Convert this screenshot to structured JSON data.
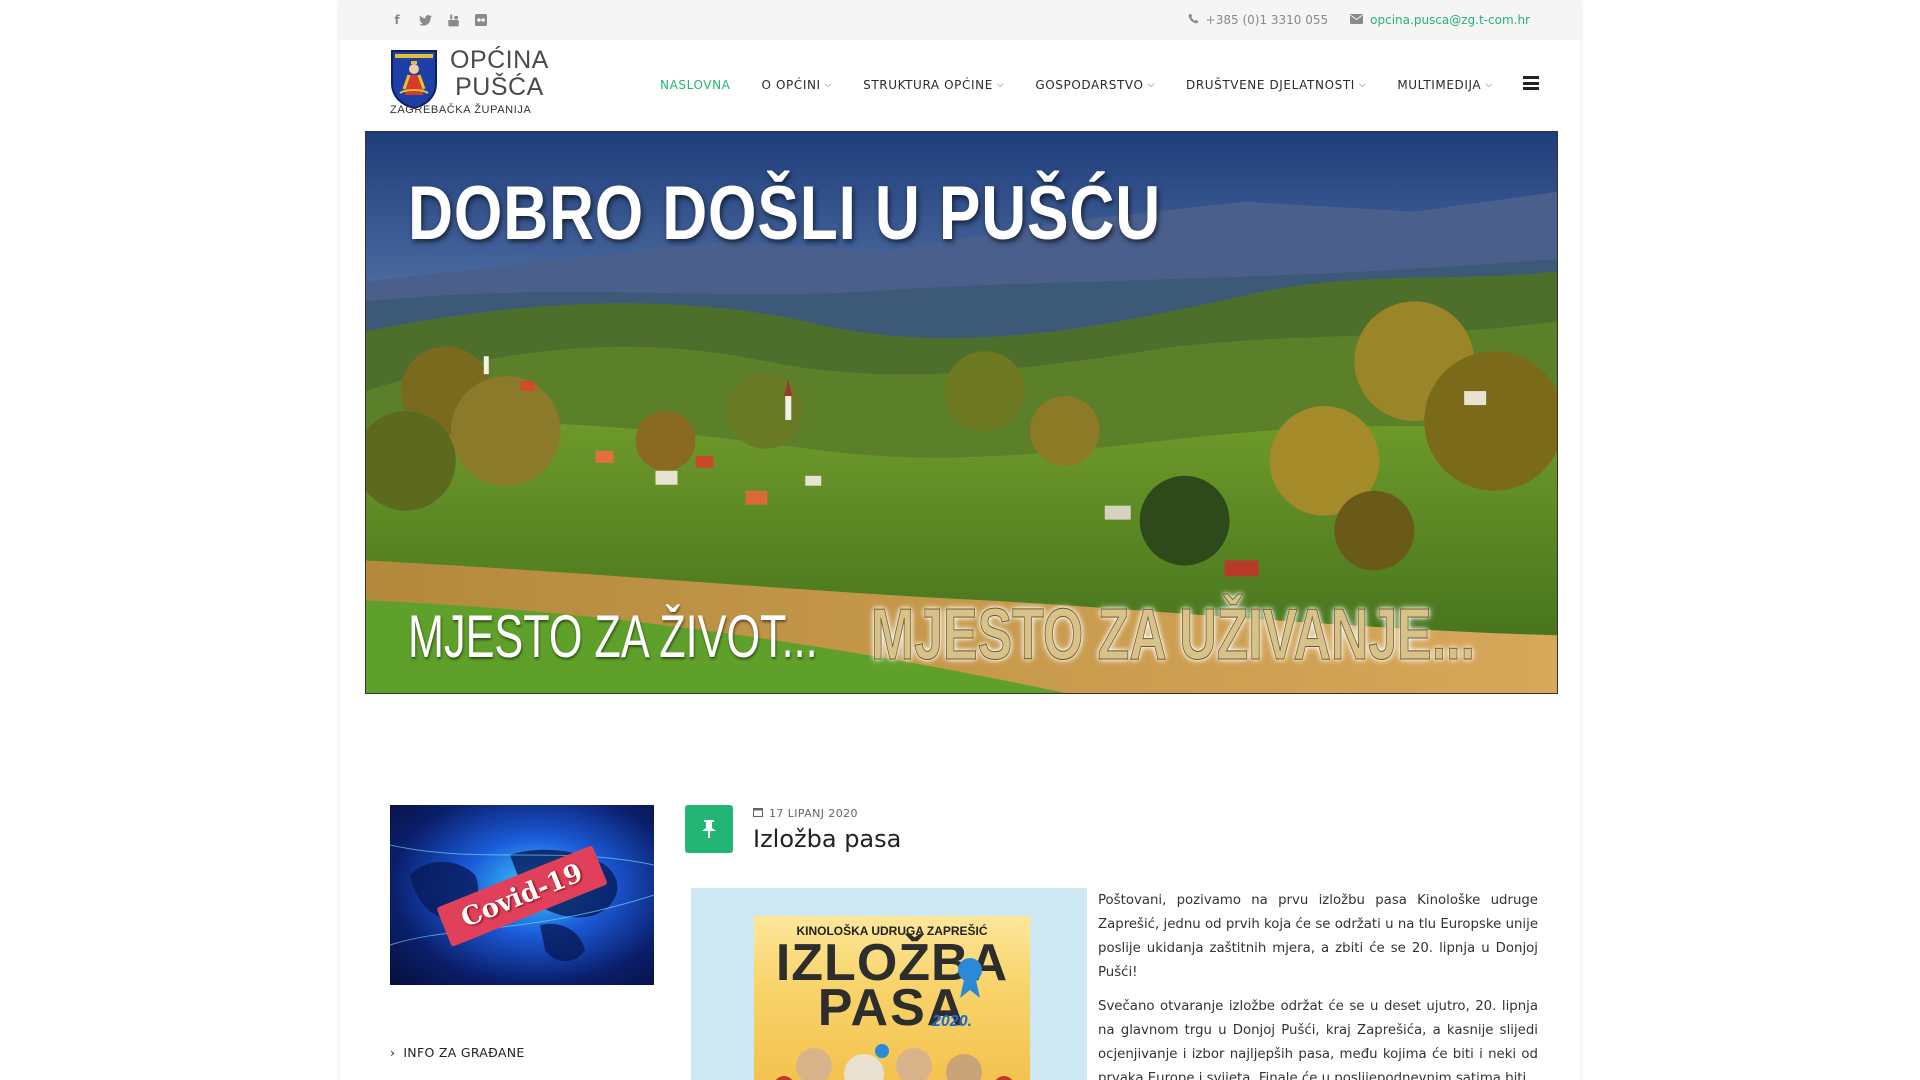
{
  "topbar": {
    "social": [
      "facebook-icon",
      "twitter-icon",
      "youtube-icon",
      "flickr-icon"
    ],
    "phone": "+385 (0)1 3310 055",
    "email": "opcina.pusca@zg.t-com.hr"
  },
  "logo": {
    "line1": "OPĆINA",
    "line2": "PUŠĆA",
    "subtitle": "ZAGREBAČKA ŽUPANIJA"
  },
  "nav": {
    "items": [
      {
        "label": "NASLOVNA",
        "active": true,
        "dropdown": false
      },
      {
        "label": "O OPĆINI",
        "active": false,
        "dropdown": true
      },
      {
        "label": "STRUKTURA OPĆINE",
        "active": false,
        "dropdown": true
      },
      {
        "label": "GOSPODARSTVO",
        "active": false,
        "dropdown": true
      },
      {
        "label": "DRUŠTVENE DJELATNOSTI",
        "active": false,
        "dropdown": true
      },
      {
        "label": "MULTIMEDIJA",
        "active": false,
        "dropdown": true
      }
    ]
  },
  "hero": {
    "title": "DOBRO DOŠLI U PUŠĆU",
    "tagline1": "MJESTO ZA ŽIVOT...",
    "tagline2": "MJESTO ZA UŽIVANJE..."
  },
  "sidebar": {
    "banner_label": "Covid-19",
    "link": "INFO ZA GRAĐANE"
  },
  "post": {
    "date": "17 LIPANJ 2020",
    "title": "Izložba pasa",
    "poster_club": "KINOLOŠKA UDRUGA ZAPREŠIĆ",
    "poster_title1": "IZLOŽBA",
    "poster_title2": "PASA",
    "poster_year": "2020.",
    "paragraph1": "Poštovani, pozivamo na prvu izložbu pasa Kinološke udruge Zaprešić, jednu od prvih koja će se održati u na tlu Europske unije poslije ukidanja zaštitnih mjera, a zbiti će se 20. lipnja u Donjoj Pušći!",
    "paragraph2": "Svečano otvaranje izložbe održat će se u deset ujutro, 20. lipnja na glavnom trgu u Donjoj Pušći, kraj Zaprešića, a kasnije slijedi ocjenjivanje i izbor najljepših pasa, među kojima će biti i neki od prvaka Europe i svijeta. Finale će u poslijepodnevnim satima biti"
  },
  "colors": {
    "accent": "#22b573",
    "topbar_bg": "#f5f5f5",
    "text": "#252525"
  }
}
